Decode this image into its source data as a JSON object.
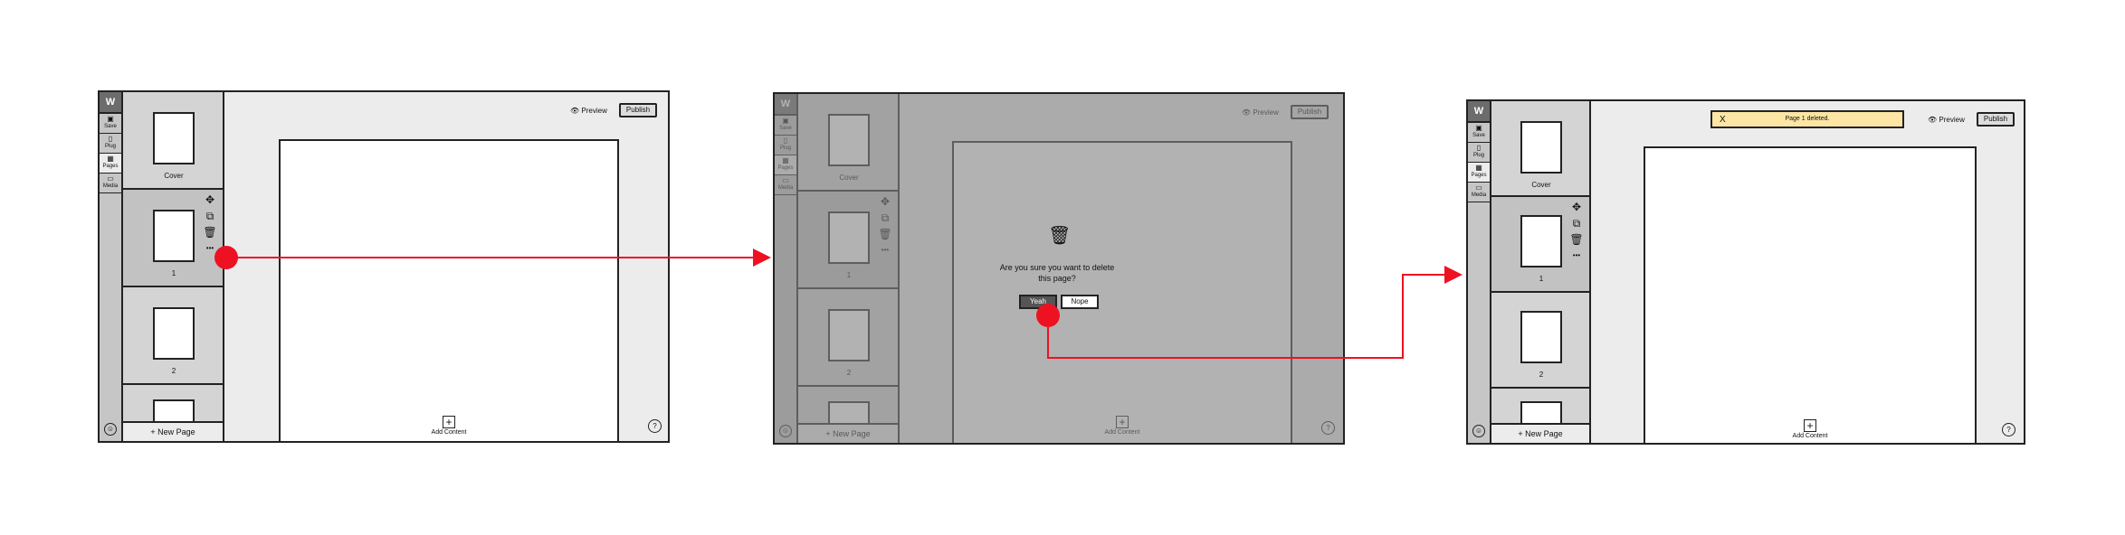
{
  "app": {
    "logo": "W",
    "rail_items": [
      {
        "icon": "▣",
        "label": "Save"
      },
      {
        "icon": "▯",
        "label": "Plug"
      },
      {
        "icon": "▦",
        "label": "Pages"
      },
      {
        "icon": "▭",
        "label": "Media"
      }
    ],
    "rail_help": "☺",
    "pages": [
      "Cover",
      "1",
      "2"
    ],
    "new_page": "+ New Page",
    "preview": "Preview",
    "publish": "Publish",
    "add_content": "Add Content",
    "help": "?",
    "more": "•••"
  },
  "dialog": {
    "question": "Are you sure you want to delete this page?",
    "yes": "Yeah",
    "no": "Nope"
  },
  "toast": {
    "close": "X",
    "message": "Page 1 deleted."
  },
  "icons": {
    "move": "move-icon",
    "copy": "copy-icon",
    "trash": "trash-icon",
    "eye": "eye-icon",
    "plus": "plus-box-icon"
  },
  "colors": {
    "flow_arrow": "#ee1122",
    "toast_bg": "#fde5a4",
    "overlay": "#8a8a8a"
  }
}
